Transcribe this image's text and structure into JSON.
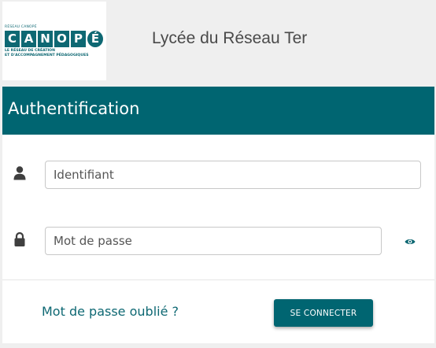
{
  "header": {
    "logo": {
      "topline": "RÉSEAU CANOPÉ",
      "letters": [
        "C",
        "A",
        "N",
        "O",
        "P",
        "É"
      ],
      "subtitle_line1": "LE RÉSEAU DE CRÉATION",
      "subtitle_line2": "ET D'ACCOMPAGNEMENT PÉDAGOGIQUES"
    },
    "site_title": "Lycée du Réseau Ter"
  },
  "auth": {
    "title": "Authentification",
    "username": {
      "placeholder": "Identifiant",
      "value": "",
      "icon": "user-icon"
    },
    "password": {
      "placeholder": "Mot de passe",
      "value": "",
      "icon": "lock-icon",
      "toggle_icon": "eye-icon"
    },
    "forgot_link": "Mot de passe oublié ?",
    "submit_label": "SE CONNECTER"
  },
  "colors": {
    "brand": "#006571",
    "link": "#0e6873",
    "background": "#efefef",
    "icon": "#3f3f3f"
  }
}
